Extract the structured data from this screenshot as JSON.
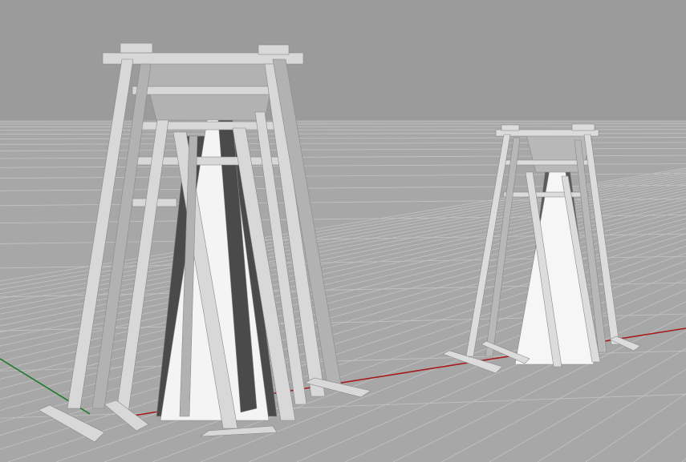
{
  "viewport": {
    "view_type": "perspective",
    "display_mode": "shaded",
    "background_color": "#9b9b9b",
    "ground_color": "#a7a7a7",
    "grid_line_color": "#c3c3c3",
    "x_axis_color": "#a61b1b",
    "y_axis_color": "#1f7a2a"
  },
  "objects": [
    {
      "kind": "tower-scaffold",
      "shade_light": "#d8d8d8",
      "shade_mid": "#b2b2b2",
      "shade_dark": "#4a4a4a",
      "core": "#f4f4f4"
    },
    {
      "kind": "tower-scaffold",
      "shade_light": "#dcdcdc",
      "shade_mid": "#b8b8b8",
      "shade_dark": "#5a5a5a",
      "core": "#f6f6f6"
    }
  ]
}
